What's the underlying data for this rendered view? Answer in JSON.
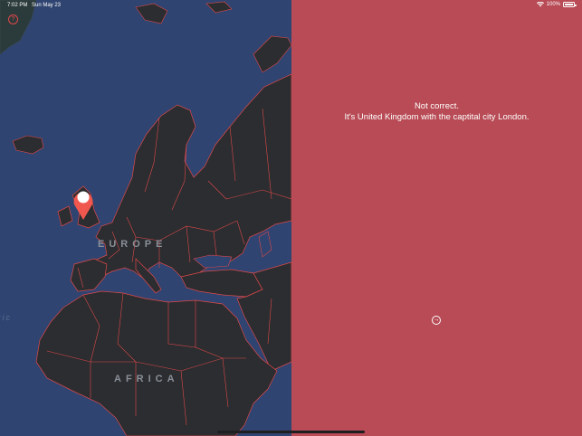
{
  "status_bar": {
    "time": "7:02 PM",
    "date": "Sun May 23",
    "battery": "100%"
  },
  "map": {
    "help_icon_glyph": "?",
    "labels": {
      "europe": "EUROPE",
      "africa": "AFRICA",
      "ocean": "tic"
    },
    "colors": {
      "ocean": "#2f4470",
      "land": "#2b2d30",
      "border": "#e0484a",
      "pin": "#f0574f"
    }
  },
  "result": {
    "line1": "Not correct.",
    "line2": "It's United Kingdom with the captital city London.",
    "next_icon_glyph": "→",
    "background": "#b84b55"
  }
}
